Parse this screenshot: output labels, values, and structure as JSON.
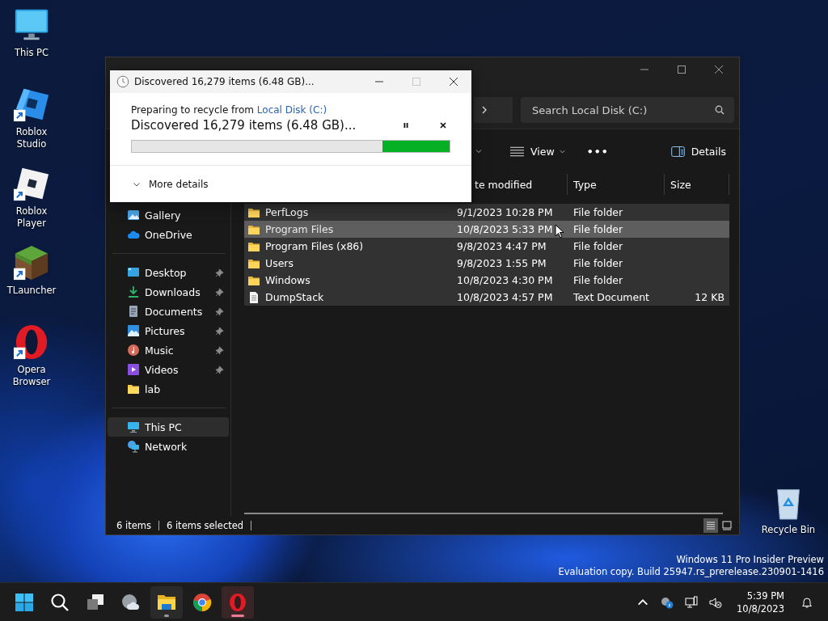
{
  "desktop_icons": [
    {
      "label": "This PC",
      "kind": "pc",
      "shortcut": false
    },
    {
      "label": "Roblox Studio",
      "kind": "roblox-studio",
      "shortcut": true
    },
    {
      "label": "Roblox Player",
      "kind": "roblox-player",
      "shortcut": true
    },
    {
      "label": "TLauncher",
      "kind": "tlauncher",
      "shortcut": true
    },
    {
      "label": "Opera Browser",
      "kind": "opera",
      "shortcut": true
    }
  ],
  "recycle_bin": {
    "label": "Recycle Bin"
  },
  "build_notice": [
    "Windows 11 Pro Insider Preview",
    "Evaluation copy. Build 25947.rs_prerelease.230901-1416"
  ],
  "explorer": {
    "search": {
      "placeholder": "Search Local Disk (C:)"
    },
    "toolbar": {
      "view": "View",
      "more": "•••",
      "details": "Details"
    },
    "nav_sections": [
      {
        "items": [
          {
            "label": "Gallery",
            "pinned": false,
            "selected": false
          },
          {
            "label": "OneDrive",
            "pinned": false,
            "selected": false
          }
        ]
      },
      {
        "items": [
          {
            "label": "Desktop",
            "pinned": true,
            "selected": false
          },
          {
            "label": "Downloads",
            "pinned": true,
            "selected": false
          },
          {
            "label": "Documents",
            "pinned": true,
            "selected": false
          },
          {
            "label": "Pictures",
            "pinned": true,
            "selected": false
          },
          {
            "label": "Music",
            "pinned": true,
            "selected": false
          },
          {
            "label": "Videos",
            "pinned": true,
            "selected": false
          },
          {
            "label": "lab",
            "pinned": false,
            "selected": false
          }
        ]
      },
      {
        "items": [
          {
            "label": "This PC",
            "pinned": false,
            "selected": true
          },
          {
            "label": "Network",
            "pinned": false,
            "selected": false
          }
        ]
      }
    ],
    "columns": [
      "te modified",
      "Type",
      "Size"
    ],
    "rows": [
      {
        "name": "PerfLogs",
        "modified": "9/1/2023 10:28 PM",
        "type": "File folder",
        "size": "",
        "kind": "folder",
        "selected": true,
        "hovered": false
      },
      {
        "name": "Program Files",
        "modified": "10/8/2023 5:33 PM",
        "type": "File folder",
        "size": "",
        "kind": "folder",
        "selected": true,
        "hovered": true
      },
      {
        "name": "Program Files (x86)",
        "modified": "9/8/2023 4:47 PM",
        "type": "File folder",
        "size": "",
        "kind": "folder",
        "selected": true,
        "hovered": false
      },
      {
        "name": "Users",
        "modified": "9/8/2023 1:55 PM",
        "type": "File folder",
        "size": "",
        "kind": "folder",
        "selected": true,
        "hovered": false
      },
      {
        "name": "Windows",
        "modified": "10/8/2023 4:30 PM",
        "type": "File folder",
        "size": "",
        "kind": "folder",
        "selected": true,
        "hovered": false
      },
      {
        "name": "DumpStack",
        "modified": "10/8/2023 4:57 PM",
        "type": "Text Document",
        "size": "12 KB",
        "kind": "text",
        "selected": true,
        "hovered": false
      }
    ],
    "status": {
      "count": "6 items",
      "selection": "6 items selected"
    },
    "views": [
      {
        "kind": "details",
        "selected": true
      },
      {
        "kind": "tiles",
        "selected": false
      }
    ]
  },
  "dialog": {
    "title": "Discovered 16,279 items (6.48 GB)...",
    "maximize_disabled": true,
    "source_prefix": "Preparing to recycle from",
    "source_link": "Local Disk (C:)",
    "status": "Discovered 16,279 items (6.48 GB)...",
    "progress": {
      "level": 0.21
    },
    "more_details": "More details"
  },
  "taskbar": {
    "apps": [
      {
        "kind": "start",
        "running": false,
        "selected": false
      },
      {
        "kind": "search",
        "running": false,
        "selected": false
      },
      {
        "kind": "taskview",
        "running": false,
        "selected": false
      },
      {
        "kind": "widgets",
        "running": false,
        "selected": false
      },
      {
        "kind": "explorer",
        "running": true,
        "selected": false
      },
      {
        "kind": "chrome",
        "running": false,
        "selected": false
      },
      {
        "kind": "opera",
        "running": true,
        "selected": true
      }
    ],
    "time": "5:39 PM",
    "date": "10/8/2023"
  }
}
